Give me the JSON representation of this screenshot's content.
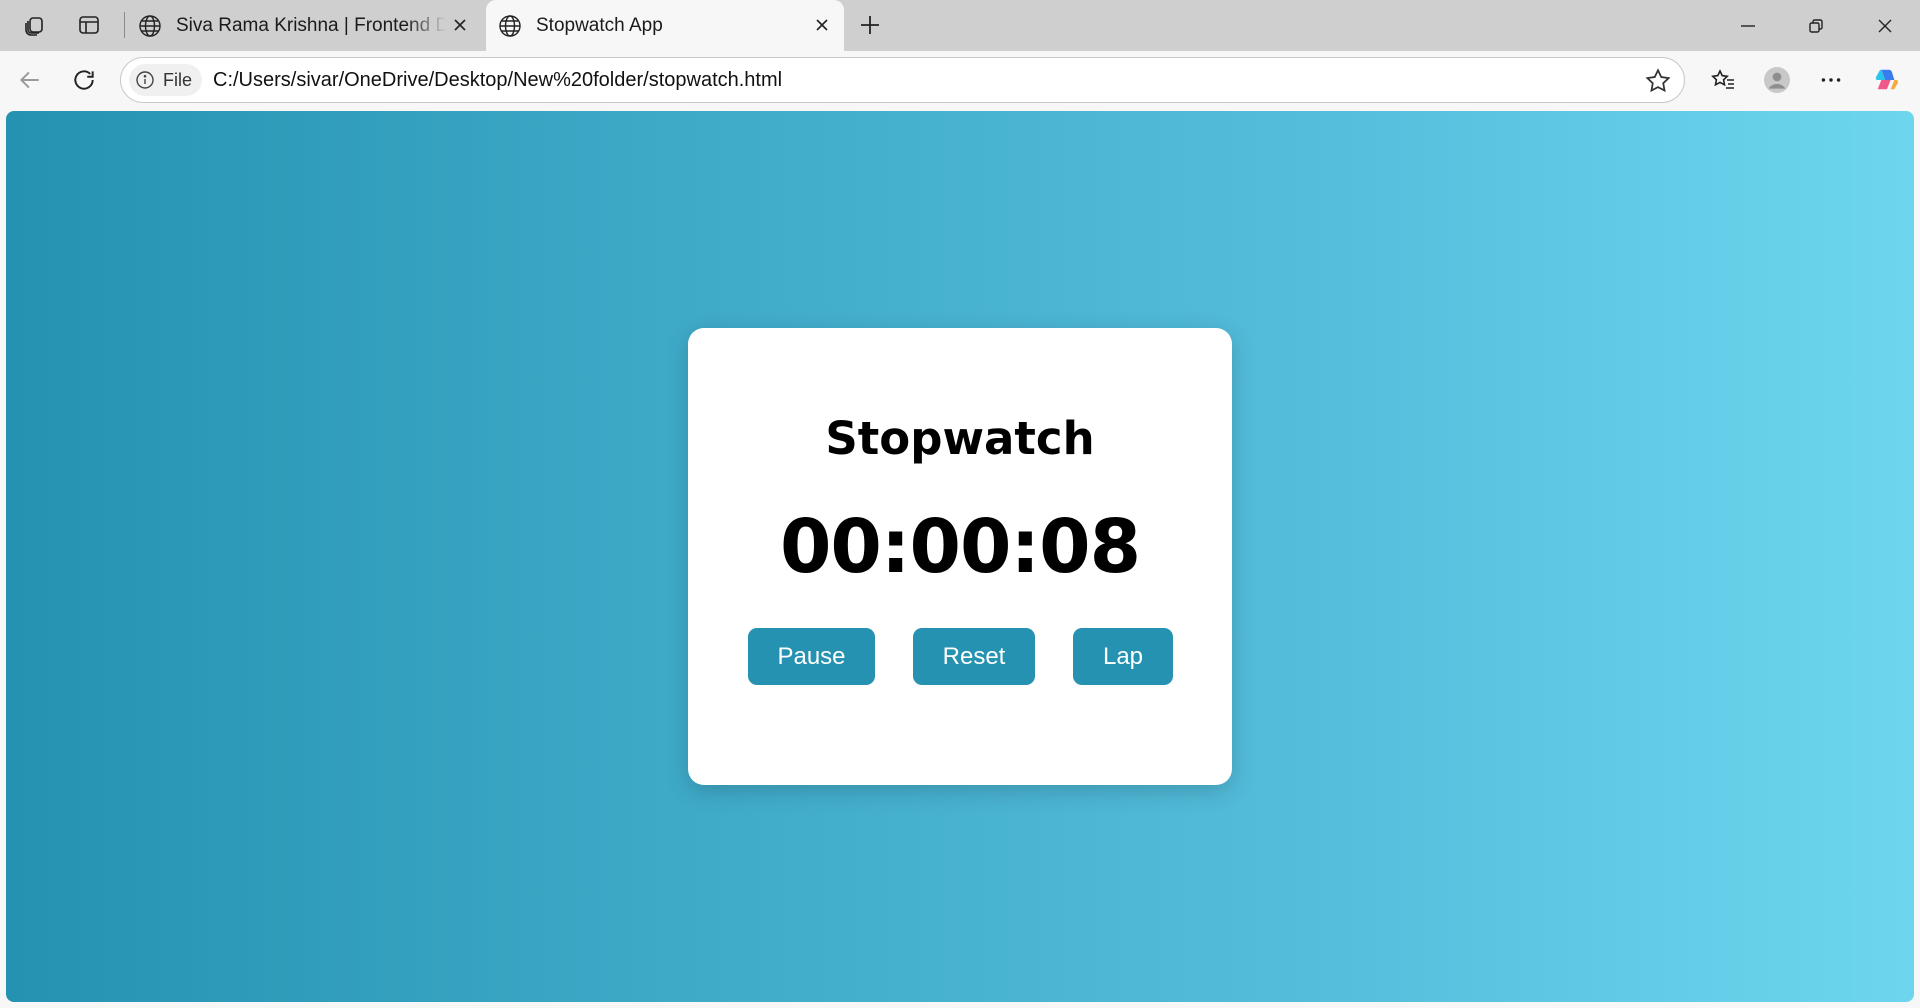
{
  "browser": {
    "tabs": [
      {
        "title": "Siva Rama Krishna | Frontend Developer",
        "active": false
      },
      {
        "title": "Stopwatch App",
        "active": true
      }
    ],
    "address": {
      "scheme_label": "File",
      "url": "C:/Users/sivar/OneDrive/Desktop/New%20folder/stopwatch.html"
    }
  },
  "page": {
    "heading": "Stopwatch",
    "time": "00:00:08",
    "buttons": {
      "pause": "Pause",
      "reset": "Reset",
      "lap": "Lap"
    }
  },
  "colors": {
    "accent": "#2592b1",
    "gradient_start": "#2592b1",
    "gradient_end": "#6dd6ee"
  },
  "icons": {
    "workspaces": "workspaces-icon",
    "tab_actions": "vertical-tabs-icon",
    "globe": "globe-icon",
    "back": "back-arrow-icon",
    "refresh": "refresh-icon",
    "info": "info-icon",
    "favorite": "star-icon",
    "favorites": "favorites-icon",
    "profile": "profile-icon",
    "more": "more-icon",
    "copilot": "copilot-icon"
  }
}
